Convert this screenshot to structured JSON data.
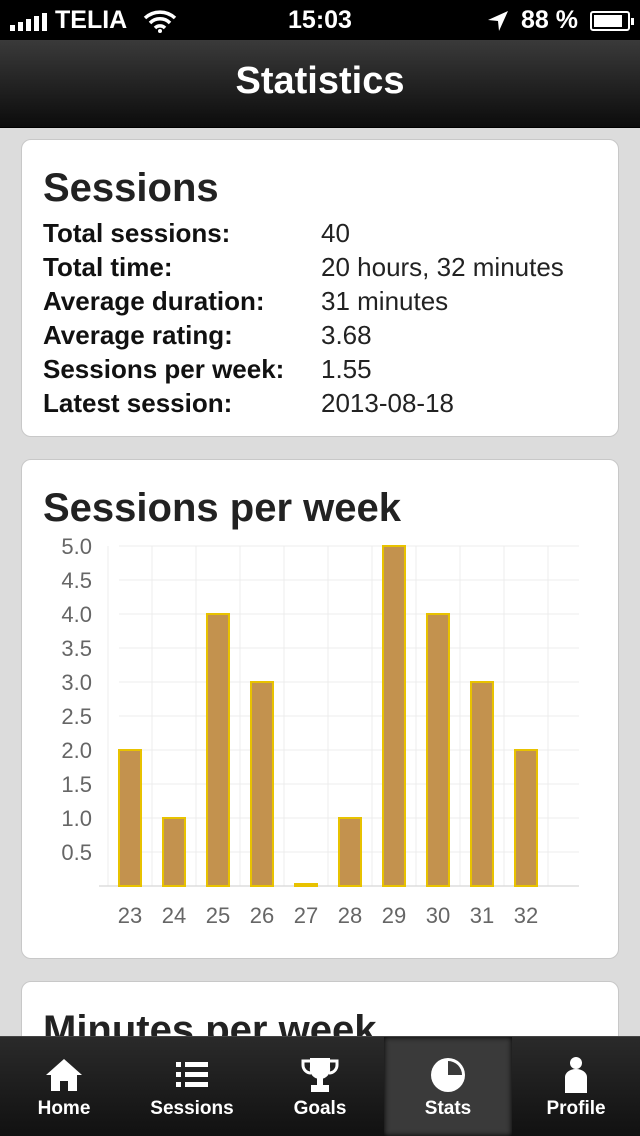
{
  "status_bar": {
    "carrier": "TELIA",
    "time": "15:03",
    "battery": "88 %",
    "battery_level": 0.88
  },
  "nav": {
    "title": "Statistics"
  },
  "sessions_card": {
    "title": "Sessions",
    "rows": [
      {
        "label": "Total sessions:",
        "value": "40"
      },
      {
        "label": "Total time:",
        "value": "20 hours, 32 minutes"
      },
      {
        "label": "Average duration:",
        "value": "31 minutes"
      },
      {
        "label": "Average rating:",
        "value": "3.68"
      },
      {
        "label": "Sessions per week:",
        "value": "1.55"
      },
      {
        "label": "Latest session:",
        "value": "2013-08-18"
      }
    ]
  },
  "chart_card": {
    "title": "Sessions per week"
  },
  "chart_data": {
    "type": "bar",
    "title": "Sessions per week",
    "categories": [
      "23",
      "24",
      "25",
      "26",
      "27",
      "28",
      "29",
      "30",
      "31",
      "32"
    ],
    "values": [
      2,
      1,
      4,
      3,
      0,
      1,
      5,
      4,
      3,
      2
    ],
    "ylim": [
      0,
      5
    ],
    "yticks": [
      "0.5",
      "1.0",
      "1.5",
      "2.0",
      "2.5",
      "3.0",
      "3.5",
      "4.0",
      "4.5",
      "5.0"
    ],
    "grid": true,
    "bar_color": "#c3924e",
    "bar_border": "#e8c200"
  },
  "minutes_card": {
    "title": "Minutes per week"
  },
  "tabs": [
    {
      "label": "Home",
      "icon": "home-icon"
    },
    {
      "label": "Sessions",
      "icon": "list-icon"
    },
    {
      "label": "Goals",
      "icon": "trophy-icon"
    },
    {
      "label": "Stats",
      "icon": "pie-chart-icon",
      "active": true
    },
    {
      "label": "Profile",
      "icon": "person-icon"
    }
  ]
}
